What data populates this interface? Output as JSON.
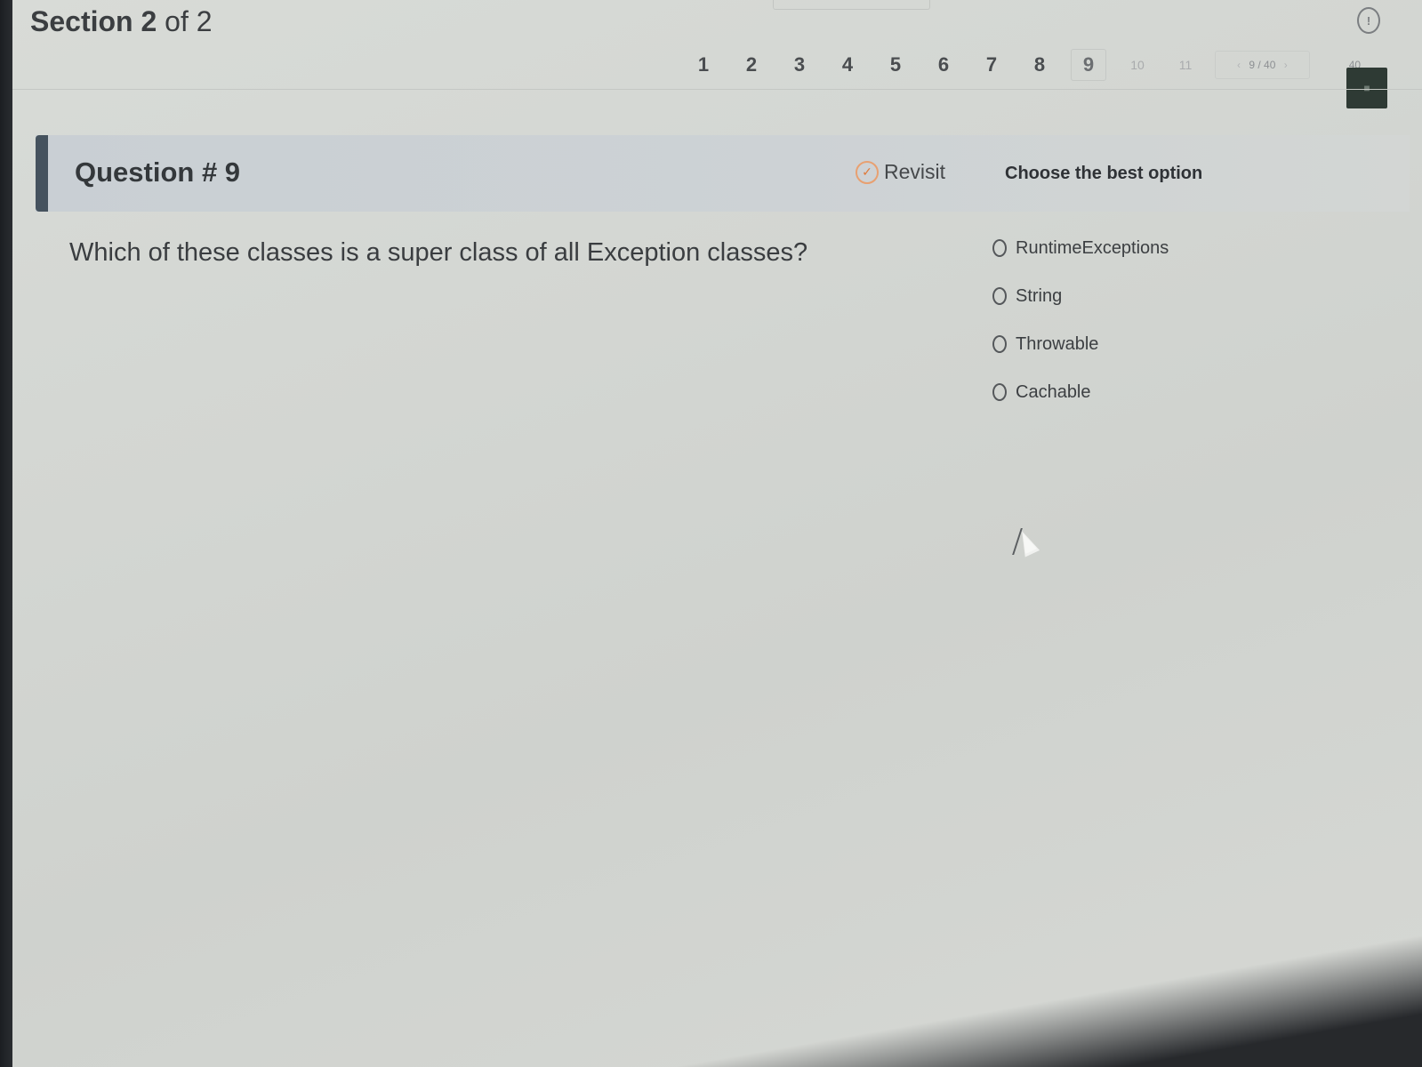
{
  "header": {
    "section_word": "Section",
    "section_current": "2",
    "section_of": "of",
    "section_total": "2"
  },
  "pager": {
    "pages": [
      "1",
      "2",
      "3",
      "4",
      "5",
      "6",
      "7",
      "8"
    ],
    "current": "9",
    "faded": [
      "10",
      "11"
    ],
    "jump_value": "9 / 40",
    "end_label": "40"
  },
  "question": {
    "title": "Question # 9",
    "revisit_label": "Revisit",
    "text": "Which of these classes is a super class of all Exception classes?",
    "options_heading": "Choose the best option",
    "options": [
      "RuntimeExceptions",
      "String",
      "Throwable",
      "Cachable"
    ]
  },
  "colors": {
    "accent_bar": "#45525e",
    "revisit_icon": "#e07a3a",
    "finish_button": "#2e3a34"
  },
  "icons": {
    "info": "info-icon",
    "revisit": "revisit-icon",
    "cursor": "mouse-cursor-icon"
  }
}
